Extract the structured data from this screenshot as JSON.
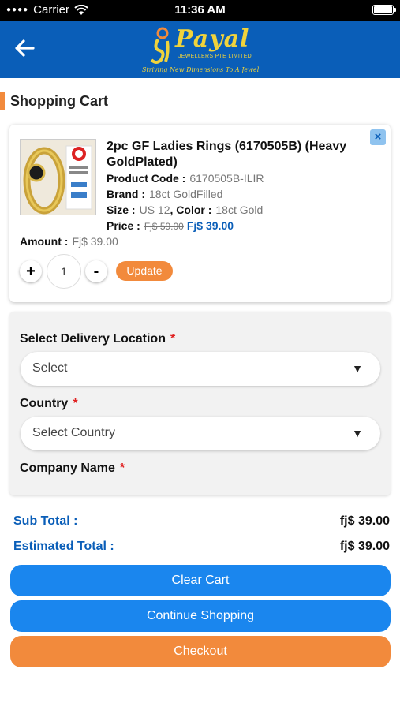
{
  "status_bar": {
    "carrier": "Carrier",
    "time": "11:36 AM"
  },
  "header": {
    "logo": {
      "brand": "Payal",
      "subtitle": "JEWELLERS PTE LIMITED",
      "tagline": "Striving New Dimensions To A Jewel"
    }
  },
  "page": {
    "title": "Shopping Cart"
  },
  "cart_item": {
    "title": "2pc GF Ladies Rings (6170505B) (Heavy GoldPlated)",
    "product_code_label": "Product Code :",
    "product_code": "6170505B-ILIR",
    "brand_label": "Brand :",
    "brand": "18ct GoldFilled",
    "size_label": "Size :",
    "size": "US 12",
    "color_label": ", Color :",
    "color": "18ct Gold",
    "price_label": "Price :",
    "old_price": "Fj$ 59.00",
    "new_price": "Fj$ 39.00",
    "amount_label": "Amount :",
    "amount": "Fj$ 39.00",
    "quantity": "1",
    "plus": "+",
    "minus": "-",
    "close": "×",
    "update_label": "Update"
  },
  "delivery_form": {
    "location_label": "Select Delivery Location",
    "location_value": "Select",
    "country_label": "Country",
    "country_value": "Select Country",
    "company_label": "Company Name",
    "required_mark": "*",
    "dropdown_arrow": "▼"
  },
  "totals": {
    "subtotal_label": "Sub Total :",
    "subtotal": "fj$ 39.00",
    "estimated_label": "Estimated Total :",
    "estimated": "fj$ 39.00"
  },
  "actions": {
    "clear_cart": "Clear Cart",
    "continue_shopping": "Continue Shopping",
    "checkout": "Checkout"
  },
  "colors": {
    "header_blue": "#0a5eb8",
    "button_blue": "#1a86ee",
    "accent_orange": "#f28a3c",
    "required_red": "#e02020"
  }
}
